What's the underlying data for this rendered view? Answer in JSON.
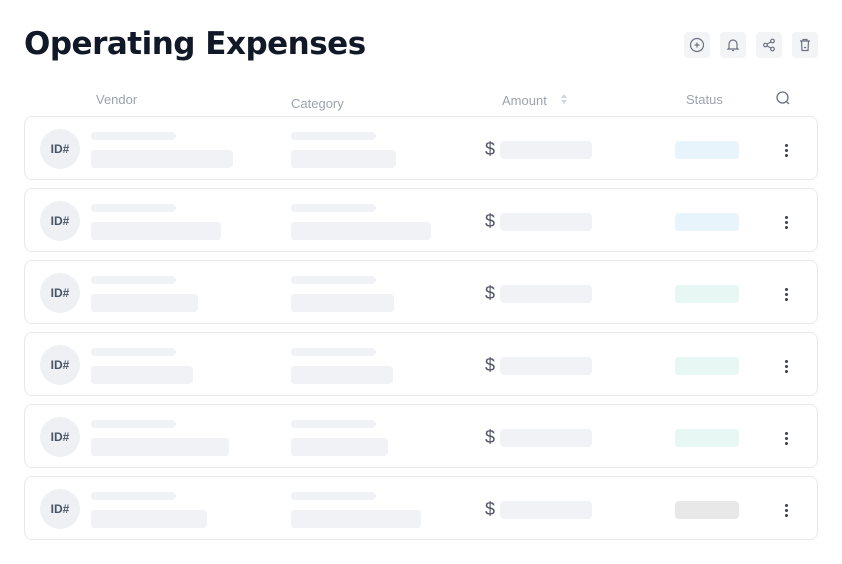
{
  "header": {
    "title": "Operating Expenses"
  },
  "toolbar": {
    "buttons": [
      {
        "name": "add-button",
        "icon": "plus-circle-icon"
      },
      {
        "name": "notifications-button",
        "icon": "bell-icon"
      },
      {
        "name": "share-button",
        "icon": "share-icon"
      },
      {
        "name": "delete-button",
        "icon": "trash-icon"
      }
    ]
  },
  "columns": {
    "vendor": "Vendor",
    "category": "Category",
    "amount": "Amount",
    "status": "Status"
  },
  "rows": [
    {
      "avatar": "ID#",
      "currency": "$",
      "status_color": "#e8f4fb"
    },
    {
      "avatar": "ID#",
      "currency": "$",
      "status_color": "#e8f4fb"
    },
    {
      "avatar": "ID#",
      "currency": "$",
      "status_color": "#e6f7f4"
    },
    {
      "avatar": "ID#",
      "currency": "$",
      "status_color": "#e6f7f4"
    },
    {
      "avatar": "ID#",
      "currency": "$",
      "status_color": "#e6f7f4"
    },
    {
      "avatar": "ID#",
      "currency": "$",
      "status_color": "#e8e8e8"
    }
  ]
}
